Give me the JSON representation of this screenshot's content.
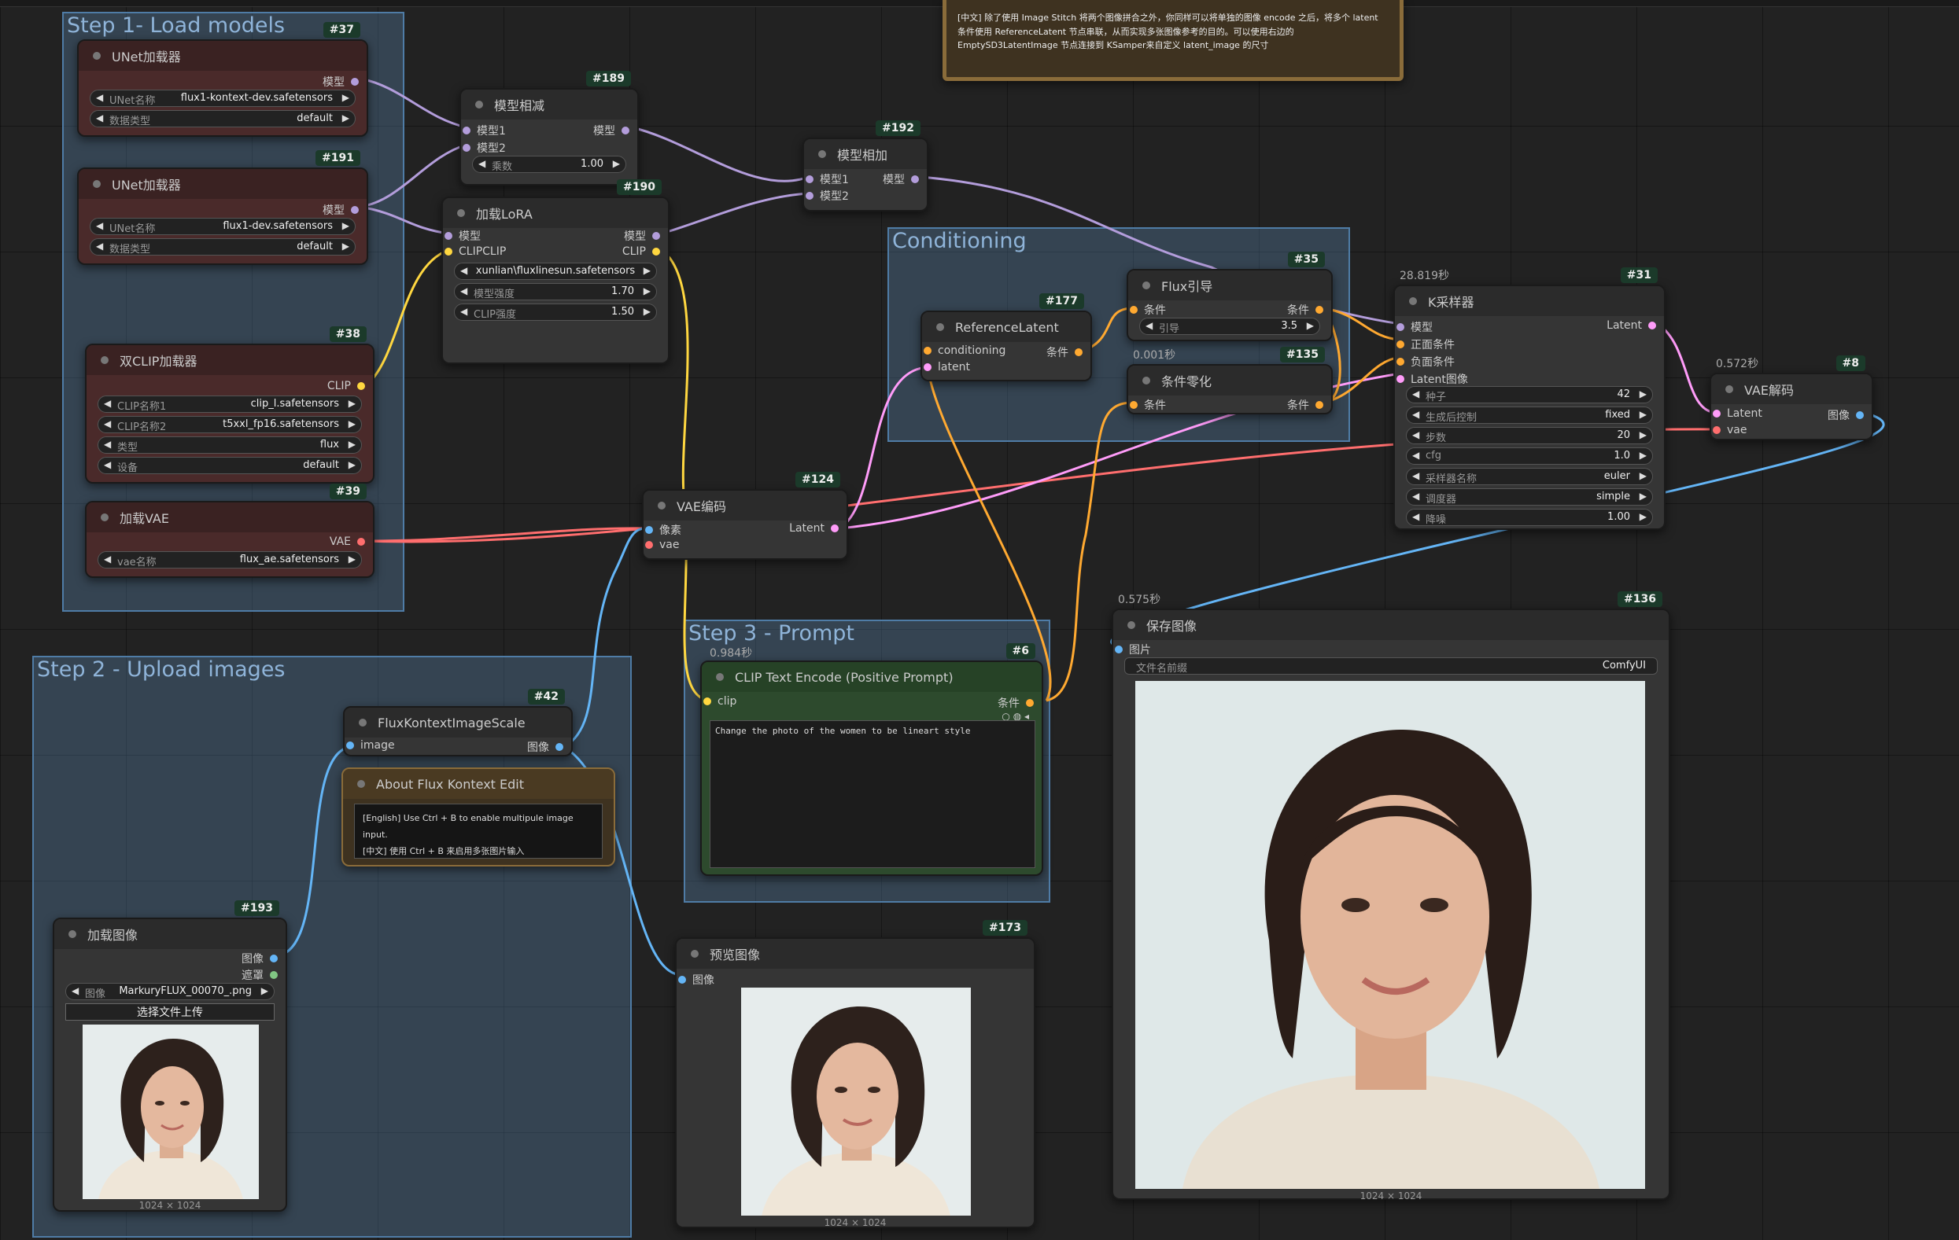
{
  "groups": {
    "step1": "Step 1- Load models",
    "step2": "Step 2 - Upload images",
    "step3": "Step 3 - Prompt",
    "conditioning": "Conditioning"
  },
  "note_top": "[中文] 除了使用 Image Stitch 将两个图像拼合之外，你同样可以将单独的图像 encode 之后，将多个 latent 条件使用 ReferenceLatent 节点串联，从而实现多张图像参考的目的。可以使用右边的 EmptySD3LatentImage 节点连接到 KSamper来自定义 latent_image 的尺寸",
  "nodes": {
    "unet1": {
      "id": "#37",
      "title": "UNet加载器",
      "out": "模型",
      "w1_label": "UNet名称",
      "w1_value": "flux1-kontext-dev.safetensors",
      "w2_label": "数据类型",
      "w2_value": "default"
    },
    "unet2": {
      "id": "#191",
      "title": "UNet加载器",
      "out": "模型",
      "w1_label": "UNet名称",
      "w1_value": "flux1-dev.safetensors",
      "w2_label": "数据类型",
      "w2_value": "default"
    },
    "dualclip": {
      "id": "#38",
      "title": "双CLIP加载器",
      "out": "CLIP",
      "w1_label": "CLIP名称1",
      "w1_value": "clip_l.safetensors",
      "w2_label": "CLIP名称2",
      "w2_value": "t5xxl_fp16.safetensors",
      "w3_label": "类型",
      "w3_value": "flux",
      "w4_label": "设备",
      "w4_value": "default"
    },
    "vaeloader": {
      "id": "#39",
      "title": "加载VAE",
      "out": "VAE",
      "w1_label": "vae名称",
      "w1_value": "flux_ae.safetensors"
    },
    "modelsub": {
      "id": "#189",
      "title": "模型相减",
      "in1": "模型1",
      "in2": "模型2",
      "out": "模型",
      "w1_label": "乘数",
      "w1_value": "1.00"
    },
    "lora": {
      "id": "#190",
      "title": "加载LoRA",
      "in1": "模型",
      "in2": "CLIPCLIP",
      "out1": "模型",
      "out2": "CLIP",
      "w1_value": "xunlian\\fluxlinesun.safetensors",
      "w2_label": "模型强度",
      "w2_value": "1.70",
      "w3_label": "CLIP强度",
      "w3_value": "1.50"
    },
    "modeladd": {
      "id": "#192",
      "title": "模型相加",
      "in1": "模型1",
      "in2": "模型2",
      "out": "模型"
    },
    "vaeencode": {
      "id": "#124",
      "title": "VAE编码",
      "in1": "像素",
      "in2": "vae",
      "out": "Latent"
    },
    "reflatent": {
      "id": "#177",
      "title": "ReferenceLatent",
      "in1": "conditioning",
      "in2": "latent",
      "out": "条件"
    },
    "fluxguide": {
      "id": "#35",
      "title": "Flux引导",
      "in1": "条件",
      "out": "条件",
      "w1_label": "引导",
      "w1_value": "3.5"
    },
    "condzero": {
      "id": "#135",
      "timing": "0.001秒",
      "title": "条件零化",
      "in1": "条件",
      "out": "条件"
    },
    "ksampler": {
      "id": "#31",
      "timing": "28.819秒",
      "title": "K采样器",
      "in1": "模型",
      "in2": "正面条件",
      "in3": "负面条件",
      "in4": "Latent图像",
      "out": "Latent",
      "widgets": [
        {
          "label": "种子",
          "value": "42"
        },
        {
          "label": "生成后控制",
          "value": "fixed"
        },
        {
          "label": "步数",
          "value": "20"
        },
        {
          "label": "cfg",
          "value": "1.0"
        },
        {
          "label": "采样器名称",
          "value": "euler"
        },
        {
          "label": "调度器",
          "value": "simple"
        },
        {
          "label": "降噪",
          "value": "1.00"
        }
      ]
    },
    "vaedecode": {
      "id": "#8",
      "timing": "0.572秒",
      "title": "VAE解码",
      "in1": "Latent",
      "in2": "vae",
      "out": "图像"
    },
    "save": {
      "id": "#136",
      "timing": "0.575秒",
      "title": "保存图像",
      "in1": "图片",
      "w1_label": "文件名前缀",
      "w1_value": "ComfyUI",
      "caption": "1024 × 1024"
    },
    "scale": {
      "id": "#42",
      "title": "FluxKontextImageScale",
      "in1": "image",
      "out": "图像"
    },
    "about": {
      "title": "About Flux Kontext Edit",
      "line1": "[English] Use Ctrl + B to enable multipule image input.",
      "line2": "[中文] 使用 Ctrl + B 来启用多张图片输入"
    },
    "clipenc": {
      "id": "#6",
      "timing": "0.984秒",
      "title": "CLIP Text Encode (Positive Prompt)",
      "in1": "clip",
      "out": "条件",
      "text": "Change the photo of the women to be lineart style"
    },
    "loadimg": {
      "id": "#193",
      "title": "加载图像",
      "out1": "图像",
      "out2": "遮罩",
      "w1_label": "图像",
      "w1_value": "MarkuryFLUX_00070_.png",
      "upload": "选择文件上传",
      "caption": "1024 × 1024"
    },
    "preview": {
      "id": "#173",
      "title": "预览图像",
      "in1": "图像",
      "caption": "1024 × 1024"
    }
  },
  "colors": {
    "model": "#b39ddb",
    "clip": "#ffd740",
    "vae": "#ff6e6e",
    "latent": "#ff9cf9",
    "conditioning": "#ffa931",
    "image": "#64b5f6"
  }
}
